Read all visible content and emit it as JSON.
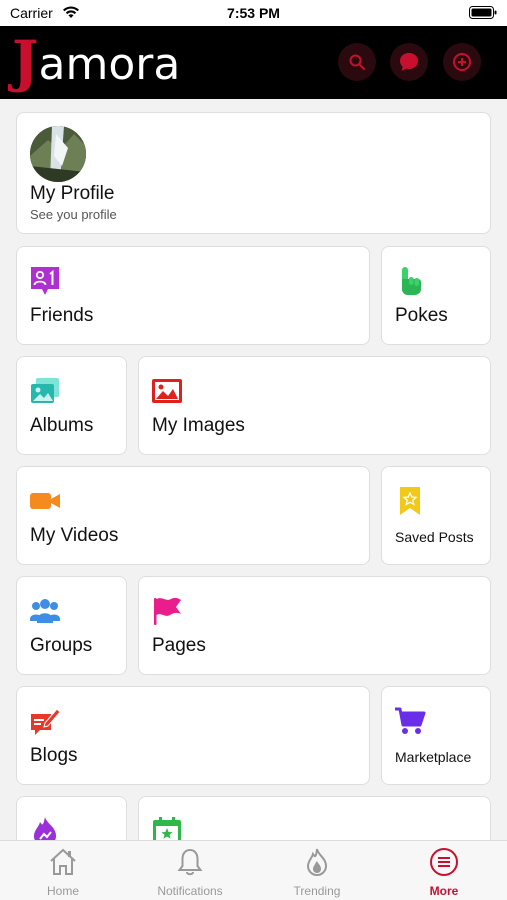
{
  "status": {
    "carrier": "Carrier",
    "time": "7:53 PM"
  },
  "header": {
    "logo_initial": "J",
    "logo_rest": "amora",
    "icons": [
      "search-icon",
      "chat-icon",
      "add-icon"
    ]
  },
  "profile": {
    "name": "My Profile",
    "subtitle": "See you profile"
  },
  "tiles": {
    "friends": "Friends",
    "pokes": "Pokes",
    "albums": "Albums",
    "my_images": "My Images",
    "my_videos": "My Videos",
    "saved_posts": "Saved Posts",
    "groups": "Groups",
    "pages": "Pages",
    "blogs": "Blogs",
    "marketplace": "Marketplace"
  },
  "tabs": [
    {
      "label": "Home",
      "icon": "home-icon"
    },
    {
      "label": "Notifications",
      "icon": "bell-icon"
    },
    {
      "label": "Trending",
      "icon": "flame-icon"
    },
    {
      "label": "More",
      "icon": "menu-icon",
      "active": true
    }
  ],
  "colors": {
    "brand": "#c8102e",
    "header_bg": "#000000",
    "active_tab": "#c8102e"
  }
}
